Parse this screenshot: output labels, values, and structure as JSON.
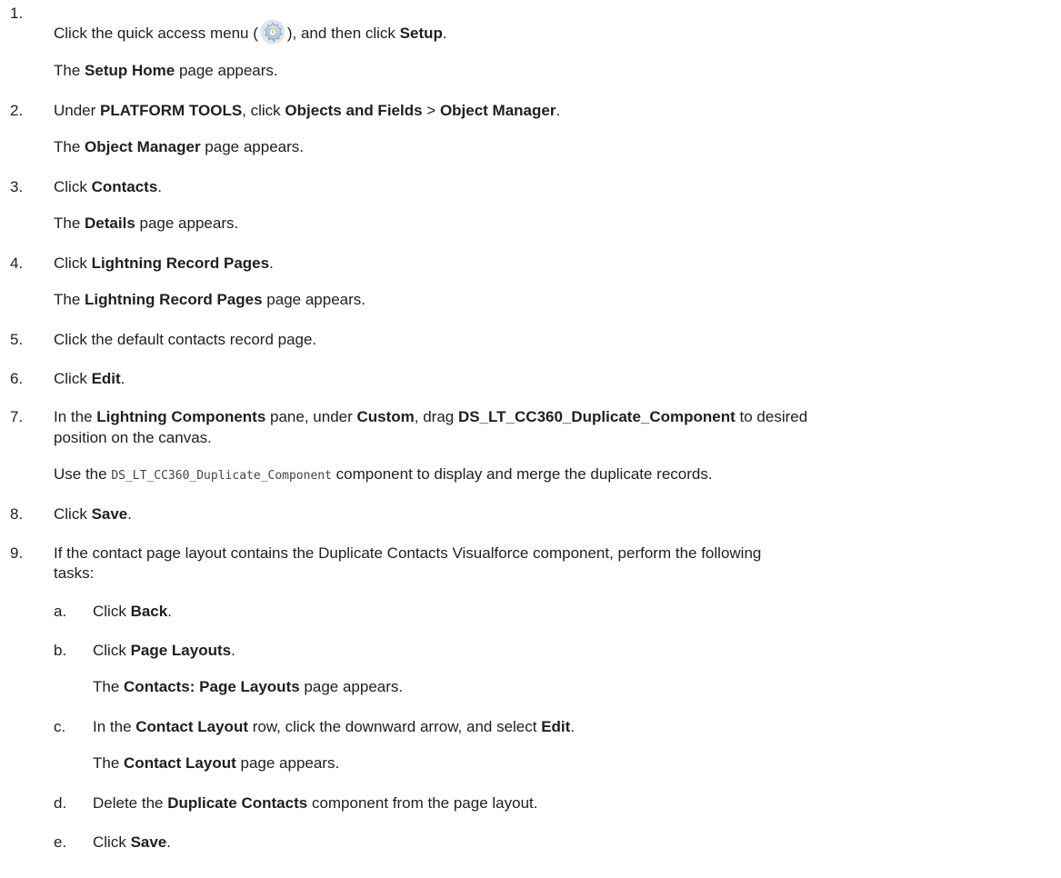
{
  "icon_names": {
    "quick_access": "gear-icon"
  },
  "steps": [
    {
      "num": "1.",
      "text": [
        "Click the quick access menu (",
        "), and then click ",
        "Setup",
        "."
      ],
      "result": [
        "The ",
        "Setup Home",
        " page appears."
      ]
    },
    {
      "num": "2.",
      "text": [
        "Under ",
        "PLATFORM TOOLS",
        ", click ",
        "Objects and Fields",
        " > ",
        "Object Manager",
        "."
      ],
      "result": [
        "The ",
        "Object Manager",
        " page appears."
      ]
    },
    {
      "num": "3.",
      "text": [
        "Click ",
        "Contacts",
        "."
      ],
      "result": [
        "The ",
        "Details",
        " page appears."
      ]
    },
    {
      "num": "4.",
      "text": [
        "Click ",
        "Lightning Record Pages",
        "."
      ],
      "result": [
        "The ",
        "Lightning Record Pages",
        " page appears."
      ]
    },
    {
      "num": "5.",
      "text": [
        "Click the default contacts record page."
      ]
    },
    {
      "num": "6.",
      "text": [
        "Click ",
        "Edit",
        "."
      ]
    },
    {
      "num": "7.",
      "text": [
        "In the ",
        "Lightning Components",
        " pane, under ",
        "Custom",
        ", drag ",
        "DS_LT_CC360_Duplicate_Component",
        " to desired"
      ],
      "text2": "position on the canvas.",
      "result": [
        "Use the ",
        "DS_LT_CC360_Duplicate_Component",
        " component to display and merge the duplicate records."
      ]
    },
    {
      "num": "8.",
      "text": [
        "Click ",
        "Save",
        "."
      ]
    },
    {
      "num": "9.",
      "text": [
        "If the contact page layout contains the Duplicate Contacts Visualforce component, perform the following"
      ],
      "text2": "tasks:"
    }
  ],
  "substeps": [
    {
      "num": "a.",
      "text": [
        "Click ",
        "Back",
        "."
      ]
    },
    {
      "num": "b.",
      "text": [
        "Click ",
        "Page Layouts",
        "."
      ],
      "result": [
        "The ",
        "Contacts: Page Layouts",
        " page appears."
      ]
    },
    {
      "num": "c.",
      "text": [
        "In the ",
        "Contact Layout",
        " row, click the downward arrow, and select ",
        "Edit",
        "."
      ],
      "result": [
        "The ",
        "Contact Layout",
        " page appears."
      ]
    },
    {
      "num": "d.",
      "text": [
        "Delete the ",
        "Duplicate Contacts",
        " component from the page layout."
      ]
    },
    {
      "num": "e.",
      "text": [
        "Click ",
        "Save",
        "."
      ]
    }
  ]
}
